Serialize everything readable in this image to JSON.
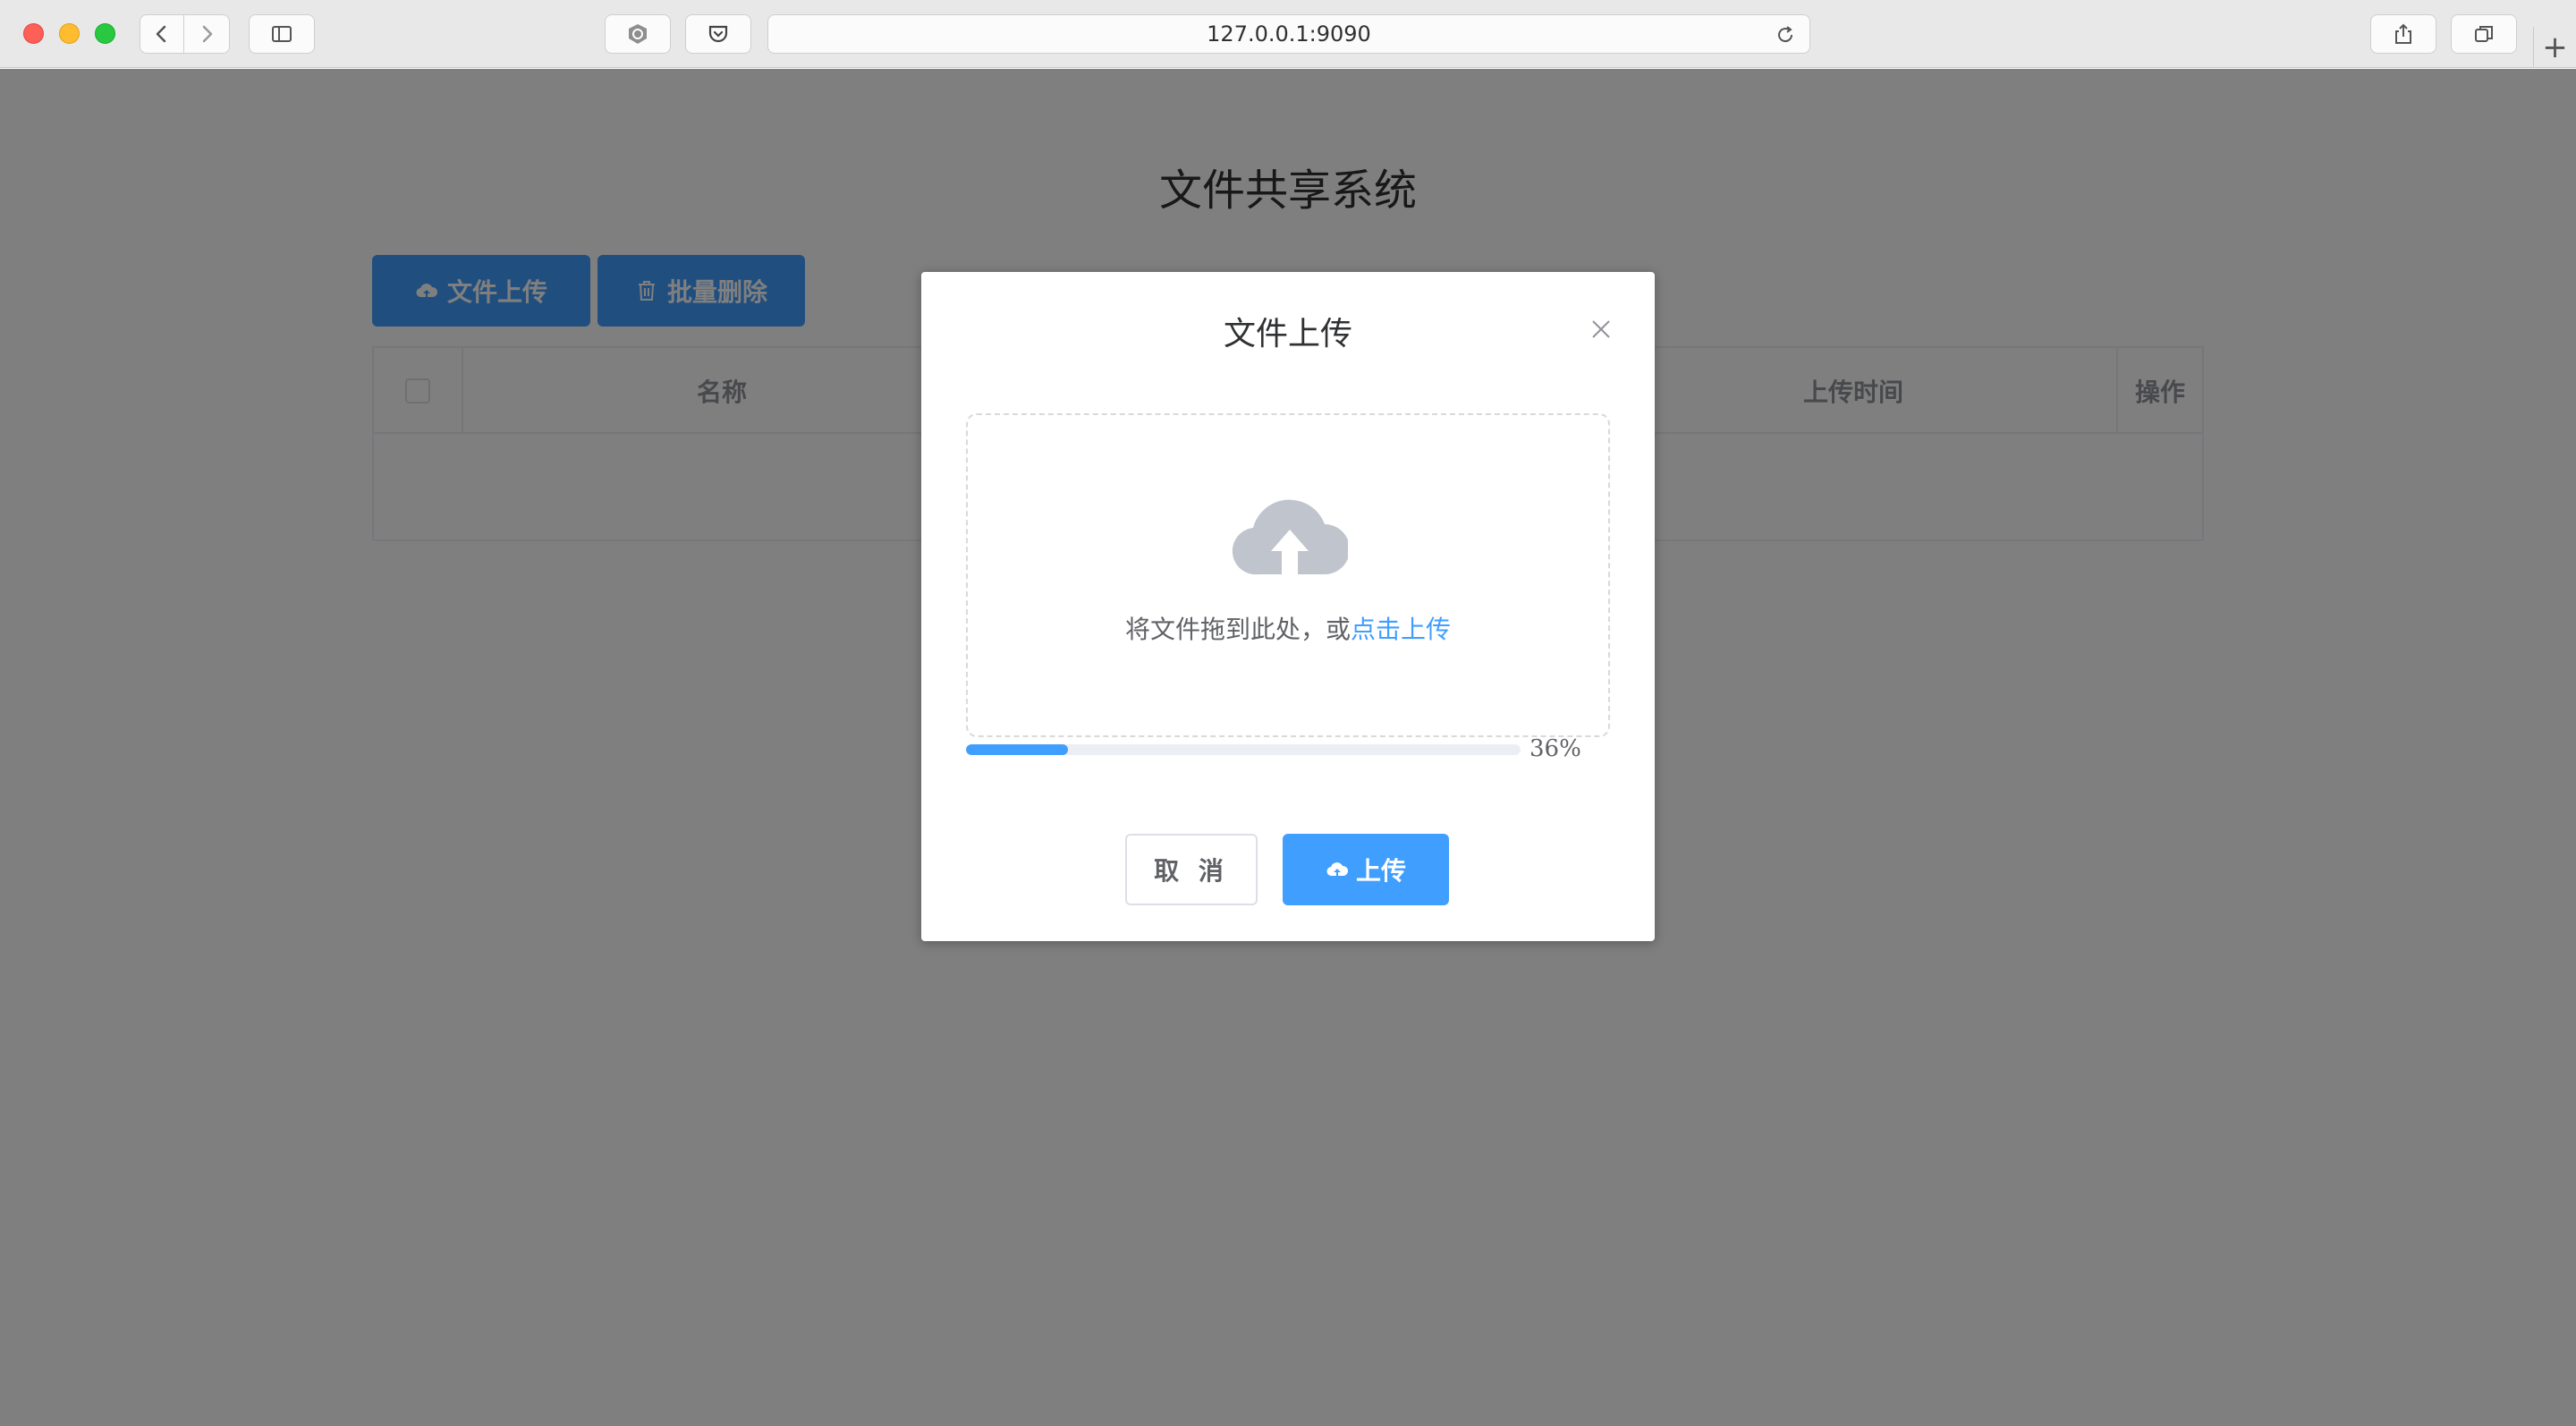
{
  "browser": {
    "url": "127.0.0.1:9090",
    "newtab_symbol": "+"
  },
  "page": {
    "title": "文件共享系统",
    "upload_button": "文件上传",
    "batch_delete_button": "批量删除",
    "table": {
      "columns": [
        "名称",
        "",
        "上传时间",
        "操作"
      ]
    }
  },
  "dialog": {
    "title": "文件上传",
    "drop_text": "将文件拖到此处，或",
    "drop_link": "点击上传",
    "progress_percent": 36,
    "progress_text": "36%",
    "cancel_button": "取 消",
    "confirm_button": "上传"
  },
  "colors": {
    "primary": "#409eff",
    "overlay": "rgba(0,0,0,0.5)"
  }
}
